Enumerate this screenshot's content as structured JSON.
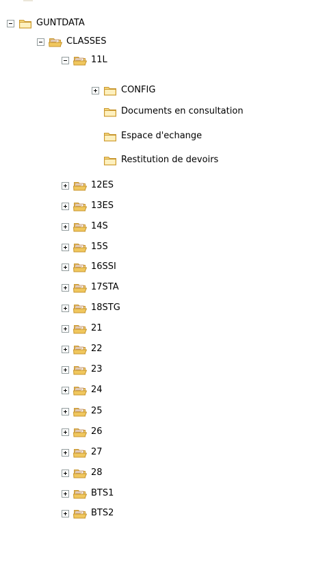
{
  "tree": {
    "root": {
      "label": "GUNTDATA",
      "state": "open",
      "icon": "folder-closed-icon"
    },
    "classes": {
      "label": "CLASSES",
      "state": "open",
      "icon": "folder-open-icon"
    },
    "class_11l": {
      "label": "11L",
      "state": "open",
      "icon": "folder-open-icon"
    },
    "class_11l_children": [
      {
        "label": "CONFIG",
        "state": "collapsed",
        "icon": "folder-closed-icon"
      },
      {
        "label": "Documents en consultation",
        "state": "leaf",
        "icon": "folder-closed-icon"
      },
      {
        "label": "Espace d'echange",
        "state": "leaf",
        "icon": "folder-closed-icon"
      },
      {
        "label": "Restitution de devoirs",
        "state": "leaf",
        "icon": "folder-closed-icon"
      }
    ],
    "classes_children": [
      {
        "label": "12ES",
        "state": "collapsed",
        "icon": "folder-open-icon"
      },
      {
        "label": "13ES",
        "state": "collapsed",
        "icon": "folder-open-icon"
      },
      {
        "label": "14S",
        "state": "collapsed",
        "icon": "folder-open-icon"
      },
      {
        "label": "15S",
        "state": "collapsed",
        "icon": "folder-open-icon"
      },
      {
        "label": "16SSI",
        "state": "collapsed",
        "icon": "folder-open-icon"
      },
      {
        "label": "17STA",
        "state": "collapsed",
        "icon": "folder-open-icon"
      },
      {
        "label": "18STG",
        "state": "collapsed",
        "icon": "folder-open-icon"
      },
      {
        "label": "21",
        "state": "collapsed",
        "icon": "folder-open-icon"
      },
      {
        "label": "22",
        "state": "collapsed",
        "icon": "folder-open-icon"
      },
      {
        "label": "23",
        "state": "collapsed",
        "icon": "folder-open-icon"
      },
      {
        "label": "24",
        "state": "collapsed",
        "icon": "folder-open-icon"
      },
      {
        "label": "25",
        "state": "collapsed",
        "icon": "folder-open-icon"
      },
      {
        "label": "26",
        "state": "collapsed",
        "icon": "folder-open-icon"
      },
      {
        "label": "27",
        "state": "collapsed",
        "icon": "folder-open-icon"
      },
      {
        "label": "28",
        "state": "collapsed",
        "icon": "folder-open-icon"
      },
      {
        "label": "BTS1",
        "state": "collapsed",
        "icon": "folder-open-icon"
      },
      {
        "label": "BTS2",
        "state": "collapsed",
        "icon": "folder-open-icon"
      }
    ]
  },
  "colors": {
    "folder_fill": "#f5d67c",
    "folder_light": "#fdf0bf",
    "folder_edge": "#c8962d",
    "folder_contents": "#b0743a",
    "expander_border": "#919b9c"
  }
}
